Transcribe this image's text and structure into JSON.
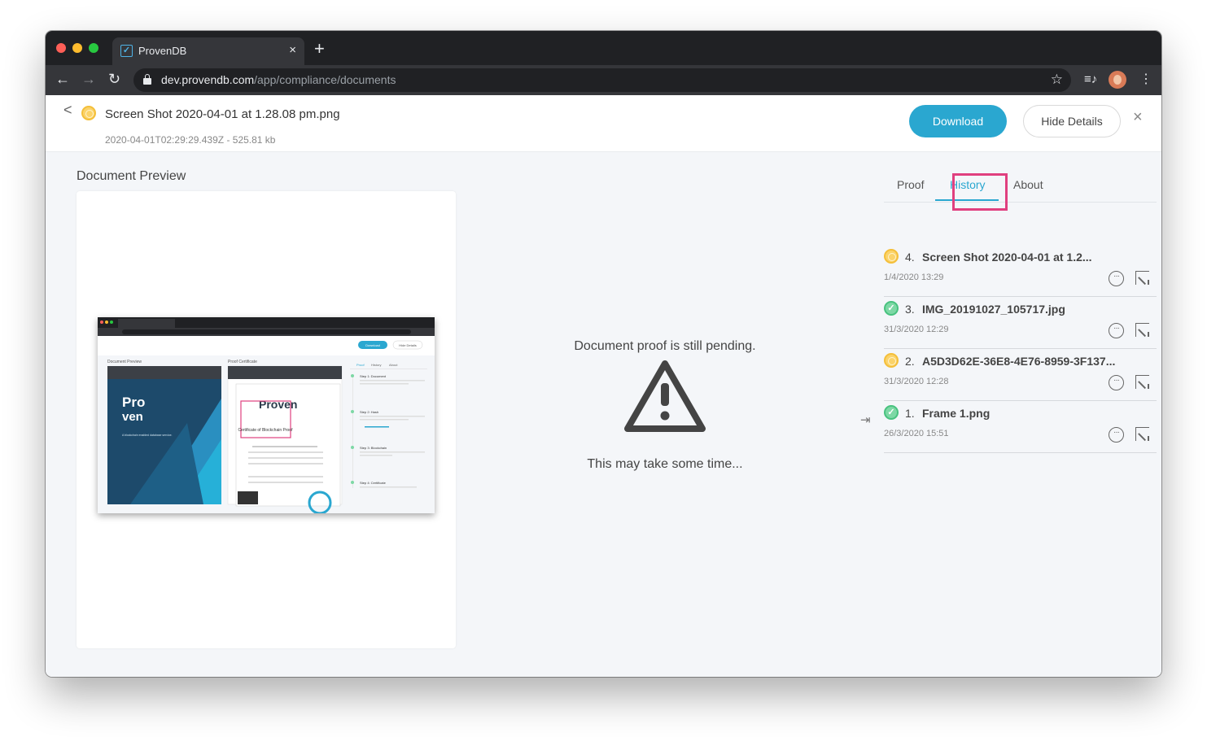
{
  "browser": {
    "tab_title": "ProvenDB",
    "tab_close": "×",
    "new_tab": "+",
    "url_host": "dev.provendb.com",
    "url_path": "/app/compliance/documents",
    "colors": {
      "tabbar": "#202124",
      "toolbar": "#35363a",
      "close": "#ff5f57",
      "minimize": "#febc2e",
      "maximize": "#28c840"
    }
  },
  "header": {
    "back": "<",
    "title": "Screen Shot 2020-04-01 at 1.28.08 pm.png",
    "meta": "2020-04-01T02:29:29.439Z - 525.81 kb",
    "download_label": "Download",
    "hide_details_label": "Hide Details",
    "close": "×",
    "accent": "#2aa7d0"
  },
  "preview": {
    "label": "Document Preview",
    "pending_text": "Document proof is still pending.",
    "wait_text": "This may take some time..."
  },
  "sidebar": {
    "tabs": [
      {
        "label": "Proof"
      },
      {
        "label": "History"
      },
      {
        "label": "About"
      }
    ],
    "active_tab": "History",
    "highlight_color": "#e0407f",
    "history": [
      {
        "num": "4.",
        "name": "Screen Shot 2020-04-01 at 1.2...",
        "date": "1/4/2020 13:29",
        "status": "pending"
      },
      {
        "num": "3.",
        "name": "IMG_20191027_105717.jpg",
        "date": "31/3/2020 12:29",
        "status": "proven"
      },
      {
        "num": "2.",
        "name": "A5D3D62E-36E8-4E76-8959-3F137...",
        "date": "31/3/2020 12:28",
        "status": "pending"
      },
      {
        "num": "1.",
        "name": "Frame 1.png",
        "date": "26/3/2020 15:51",
        "status": "proven"
      }
    ]
  },
  "thumbnail": {
    "proof_certificate": "Proof Certificate",
    "document_preview": "Document Preview",
    "brand_pro": "Pro",
    "brand_ven": "ven",
    "tagline": "A blockchain enabled database service.",
    "cert_brand": "Proven",
    "cert_title": "Certificate of Blockchain Proof",
    "tabs": [
      "Proof",
      "History",
      "About"
    ],
    "steps": [
      "Step 1: Document",
      "Step 2: Hash",
      "Step 3: Blockchain",
      "Step 4: Certificate"
    ],
    "download": "Download",
    "hide": "Hide Details"
  }
}
